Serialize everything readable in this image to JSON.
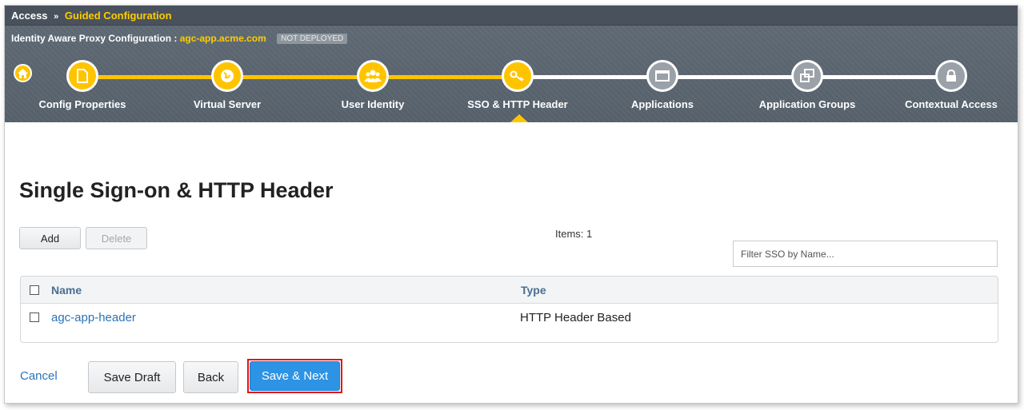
{
  "breadcrumb": {
    "root": "Access",
    "separator": "»",
    "current": "Guided Configuration"
  },
  "config": {
    "label": "Identity Aware Proxy Configuration : ",
    "host": "agc-app.acme.com",
    "status_badge": "NOT DEPLOYED"
  },
  "steps": [
    {
      "label": "Config Properties",
      "icon": "document-icon",
      "state": "done"
    },
    {
      "label": "Virtual Server",
      "icon": "globe-icon",
      "state": "done"
    },
    {
      "label": "User Identity",
      "icon": "users-icon",
      "state": "done"
    },
    {
      "label": "SSO & HTTP Header",
      "icon": "key-icon",
      "state": "current"
    },
    {
      "label": "Applications",
      "icon": "window-icon",
      "state": "todo"
    },
    {
      "label": "Application Groups",
      "icon": "app-groups-icon",
      "state": "todo"
    },
    {
      "label": "Contextual Access",
      "icon": "lock-icon",
      "state": "todo"
    }
  ],
  "page": {
    "title": "Single Sign-on & HTTP Header"
  },
  "toolbar": {
    "add_label": "Add",
    "delete_label": "Delete",
    "items_count": "Items: 1",
    "filter_placeholder": "Filter SSO by Name..."
  },
  "table": {
    "columns": [
      "Name",
      "Type"
    ],
    "rows": [
      {
        "name": "agc-app-header",
        "type": "HTTP Header Based"
      }
    ]
  },
  "footer": {
    "cancel_label": "Cancel",
    "save_draft_label": "Save Draft",
    "back_label": "Back",
    "save_next_label": "Save & Next"
  },
  "colors": {
    "accent": "#ffc400",
    "primary": "#2d93e4",
    "link": "#2a73b8",
    "highlight": "#e0161b"
  }
}
